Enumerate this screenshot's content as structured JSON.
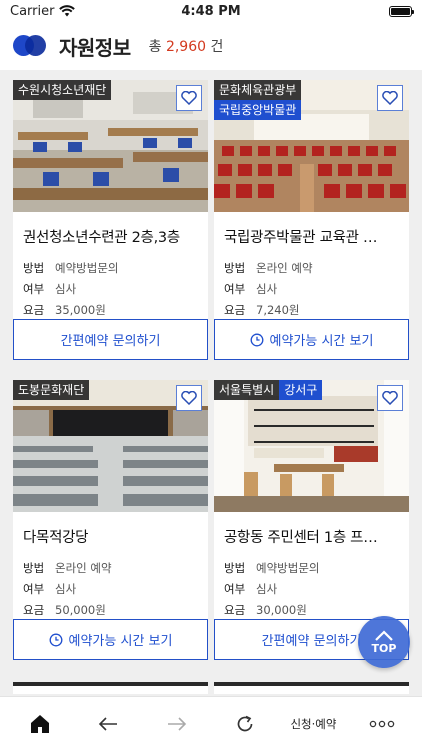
{
  "status_bar": {
    "carrier": "Carrier",
    "time": "4:48 PM"
  },
  "header": {
    "title": "자원정보",
    "count_prefix": "총",
    "count_value": "2,960",
    "count_suffix": "건"
  },
  "cards": [
    {
      "tags": [
        "수원시청소년재단"
      ],
      "tags2": [],
      "title": "권선청소년수련관 2층,3층",
      "rows": [
        {
          "label": "방법",
          "value": "예약방법문의"
        },
        {
          "label": "여부",
          "value": "심사"
        },
        {
          "label": "요금",
          "value": "35,000원"
        }
      ],
      "button": "간편예약 문의하기",
      "button_icon": ""
    },
    {
      "tags": [
        "문화체육관광부"
      ],
      "tags2": [
        "국립중앙박물관"
      ],
      "title": "국립광주박물관 교육관 …",
      "rows": [
        {
          "label": "방법",
          "value": "온라인 예약"
        },
        {
          "label": "여부",
          "value": "심사"
        },
        {
          "label": "요금",
          "value": "7,240원"
        }
      ],
      "button": "예약가능 시간 보기",
      "button_icon": "clock-icon"
    },
    {
      "tags": [
        "도봉문화재단"
      ],
      "tags2": [],
      "title": "다목적강당",
      "rows": [
        {
          "label": "방법",
          "value": "온라인 예약"
        },
        {
          "label": "여부",
          "value": "심사"
        },
        {
          "label": "요금",
          "value": "50,000원"
        }
      ],
      "button": "예약가능 시간 보기",
      "button_icon": "clock-icon"
    },
    {
      "tags": [
        "서울특별시",
        "강서구"
      ],
      "tags2": [],
      "title": "공항동 주민센터 1층 프…",
      "rows": [
        {
          "label": "방법",
          "value": "예약방법문의"
        },
        {
          "label": "여부",
          "value": "심사"
        },
        {
          "label": "요금",
          "value": "30,000원"
        }
      ],
      "button": "간편예약 문의하기",
      "button_icon": ""
    }
  ],
  "top_button": {
    "label": "TOP"
  },
  "bottom_nav": {
    "apply_label": "신청·예약"
  },
  "colors": {
    "accent": "#1f4fcf",
    "price_count": "#d33a1f"
  }
}
